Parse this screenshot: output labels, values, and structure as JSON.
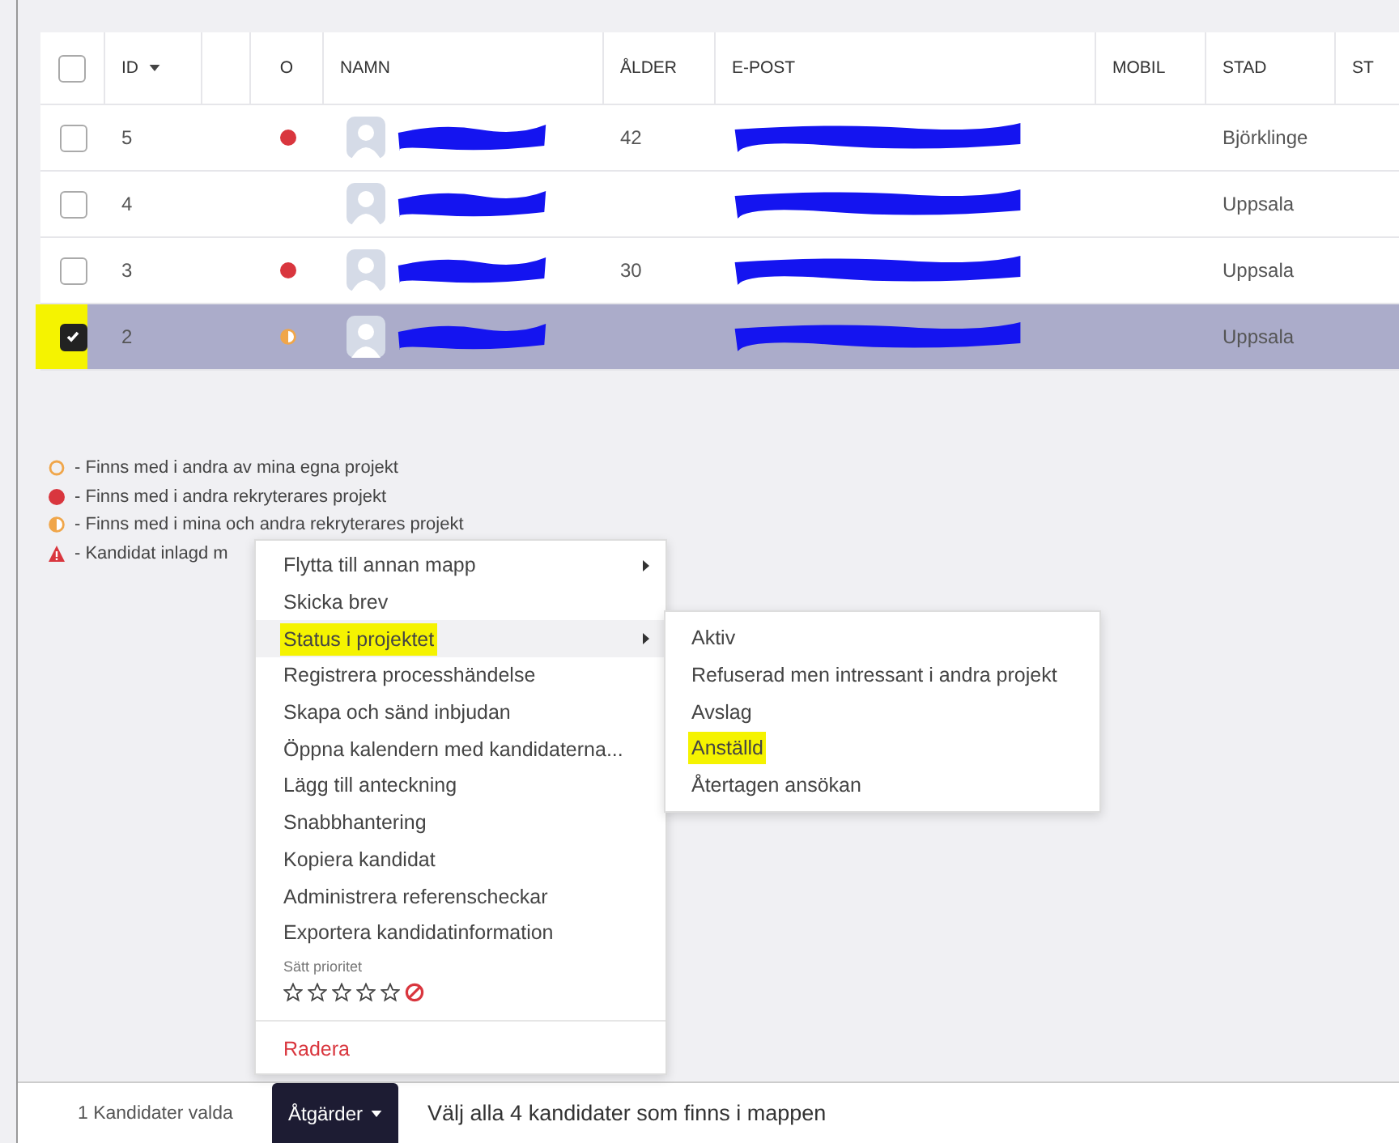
{
  "table": {
    "header_checkbox": {
      "checked": false
    },
    "columns": [
      "ID",
      "O",
      "NAMN",
      "ÅLDER",
      "E-POST",
      "MOBIL",
      "STAD",
      "ST"
    ],
    "rows": [
      {
        "checked": false,
        "highlighted": false,
        "selected": false,
        "id": "5",
        "kind": "other",
        "age": "42",
        "city": "Björklinge"
      },
      {
        "checked": false,
        "highlighted": false,
        "selected": false,
        "id": "4",
        "city": "Uppsala"
      },
      {
        "checked": false,
        "highlighted": false,
        "selected": false,
        "id": "3",
        "kind": "other",
        "age": "30",
        "city": "Uppsala"
      },
      {
        "checked": true,
        "highlighted": true,
        "selected": true,
        "id": "2",
        "kind": "both",
        "city": "Uppsala"
      }
    ]
  },
  "legend": [
    {
      "kind": "own",
      "text": "- Finns med i andra av mina egna projekt"
    },
    {
      "kind": "other",
      "text": "- Finns med i andra rekryterares projekt"
    },
    {
      "kind": "both",
      "text": "- Finns med i mina och andra rekryterares projekt"
    },
    {
      "kind": "warning",
      "text": "- Kandidat inlagd m"
    }
  ],
  "menu": {
    "items": [
      {
        "label": "Flytta till annan mapp",
        "submenu": true,
        "active": false,
        "highlighted": false
      },
      {
        "label": "Skicka brev",
        "submenu": false,
        "active": false,
        "highlighted": false
      },
      {
        "label": "Status i projektet",
        "submenu": true,
        "active": true,
        "highlighted": true
      },
      {
        "label": "Registrera processhändelse",
        "submenu": false,
        "active": false,
        "highlighted": false
      },
      {
        "label": "Skapa och sänd inbjudan",
        "submenu": false,
        "active": false,
        "highlighted": false
      },
      {
        "label": "Öppna kalendern med kandidaterna...",
        "submenu": false,
        "active": false,
        "highlighted": false
      },
      {
        "label": "Lägg till anteckning",
        "submenu": false,
        "active": false,
        "highlighted": false
      },
      {
        "label": "Snabbhantering",
        "submenu": false,
        "active": false,
        "highlighted": false
      },
      {
        "label": "Kopiera kandidat",
        "submenu": false,
        "active": false,
        "highlighted": false
      },
      {
        "label": "Administrera referenscheckar",
        "submenu": false,
        "active": false,
        "highlighted": false
      },
      {
        "label": "Exportera kandidatinformation",
        "submenu": false,
        "active": false,
        "highlighted": false
      }
    ],
    "priority": {
      "label": "Sätt prioritet",
      "stars": 0
    },
    "delete": "Radera"
  },
  "submenu": [
    {
      "label": "Aktiv",
      "highlighted": false
    },
    {
      "label": "Refuserad men intressant i andra projekt",
      "highlighted": false
    },
    {
      "label": "Avslag",
      "highlighted": false
    },
    {
      "label": "Anställd",
      "highlighted": true
    },
    {
      "label": "Återtagen ansökan",
      "highlighted": false
    }
  ],
  "footer": {
    "selection_count": "1 Kandidater valda",
    "actions_button": "Åtgärder",
    "select_all_link": "Välj alla 4 kandidater som finns i mappen"
  }
}
